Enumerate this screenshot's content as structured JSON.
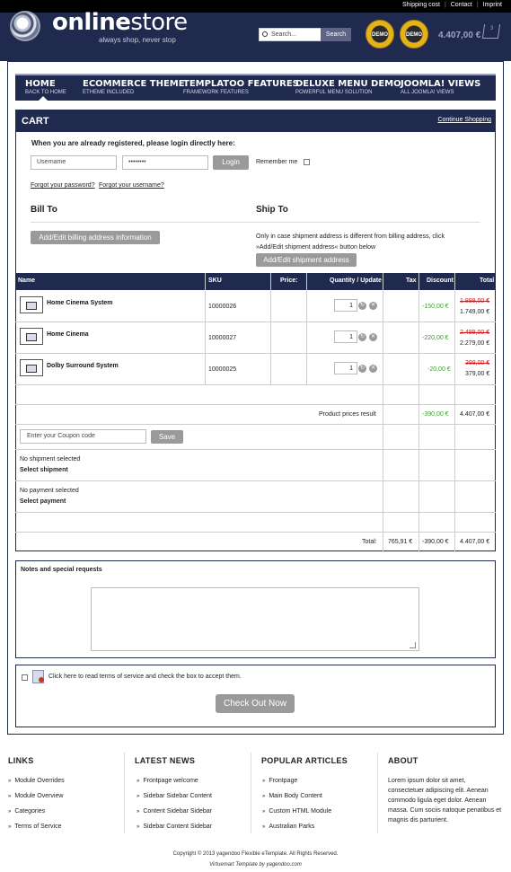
{
  "toplinks": [
    "Shipping cost",
    "Contact",
    "Imprint"
  ],
  "header": {
    "logo_bold": "online",
    "logo_light": "store",
    "tagline": "always shop, never stop",
    "search_placeholder": "Search...",
    "search_button": "Search",
    "badge1": "DEMO",
    "badge2": "DEMO",
    "cart_total": "4.407,00 €",
    "cart_count": "3"
  },
  "nav": [
    {
      "title": "HOME",
      "sub": "BACK TO HOME"
    },
    {
      "title": "ECOMMERCE THEME",
      "sub": "ETHEME INCLUDED"
    },
    {
      "title": "TEMPLATOO FEATURES",
      "sub": "FRAMEWORK FEATURES"
    },
    {
      "title": "DELUXE MENU DEMO",
      "sub": "POWERFUL MENU SOLUTION"
    },
    {
      "title": "JOOMLA! VIEWS",
      "sub": "ALL JOOMLA! VIEWS"
    }
  ],
  "cart": {
    "title": "CART",
    "continue": "Continue Shopping",
    "login_title": "When you are already registered, please login directly here:",
    "username_placeholder": "Username",
    "password_value": "••••••••",
    "login_button": "Login",
    "remember": "Remember me",
    "forgot_password": "Forgot your password?",
    "forgot_username": "Forgot your username?",
    "bill_to": "Bill To",
    "ship_to": "Ship To",
    "bill_button": "Add/Edit billing address information",
    "ship_note": "Only in case shipment address is different from billing address, click »Add/Edit shipment address« button below",
    "ship_button": "Add/Edit shipment address"
  },
  "table": {
    "headers": {
      "name": "Name",
      "sku": "SKU",
      "price": "Price:",
      "qty": "Quantity / Update",
      "tax": "Tax",
      "discount": "Discount",
      "total": "Total"
    },
    "rows": [
      {
        "name": "Home Cinema System",
        "sku": "10000026",
        "qty": "1",
        "discount": "-150,00 €",
        "old_total": "1.899,00 €",
        "total": "1.749,00 €"
      },
      {
        "name": "Home Cinema",
        "sku": "10000027",
        "qty": "1",
        "discount": "-220,00 €",
        "old_total": "2.499,00 €",
        "total": "2.279,00 €"
      },
      {
        "name": "Dolby Surround System",
        "sku": "10000025",
        "qty": "1",
        "discount": "-20,00 €",
        "old_total": "399,00 €",
        "total": "379,00 €"
      }
    ],
    "prices_result_label": "Product prices result",
    "prices_result_discount": "-390,00 €",
    "prices_result_total": "4.407,00 €",
    "coupon_placeholder": "Enter your Coupon code",
    "coupon_button": "Save",
    "no_shipment": "No shipment selected",
    "select_shipment": "Select shipment",
    "no_payment": "No payment selected",
    "select_payment": "Select payment",
    "total_label": "Total:",
    "total_tax": "765,91 €",
    "total_discount": "-390,00 €",
    "total_total": "4.407,00 €"
  },
  "notes_title": "Notes and special requests",
  "terms_text": "Click here to read terms of service and check the box to accept them.",
  "checkout_button": "Check Out Now",
  "footer": {
    "links_head": "LINKS",
    "links": [
      "Module Overrides",
      "Module Overview",
      "Categories",
      "Terms of Service"
    ],
    "news_head": "LATEST NEWS",
    "news": [
      "Frontpage welcome",
      "Sidebar Sidebar Content",
      "Content Sidebar Sidebar",
      "Sidebar Content Sidebar"
    ],
    "popular_head": "POPULAR ARTICLES",
    "popular": [
      "Frontpage",
      "Main Body Content",
      "Custom HTML Module",
      "Australian Parks"
    ],
    "about_head": "ABOUT",
    "about_text": "Lorem ipsum dolor sit amet, consectetuer adipiscing elit. Aenean commodo ligula eget dolor. Aenean massa. Cum sociis natoque penatibus et magnis dis parturient.",
    "copyright": "Copyright © 2013 yagendoo Flexible eTemplate. All Rights Reserved.",
    "credit": "Virtuemart Template by yagendoo.com"
  }
}
